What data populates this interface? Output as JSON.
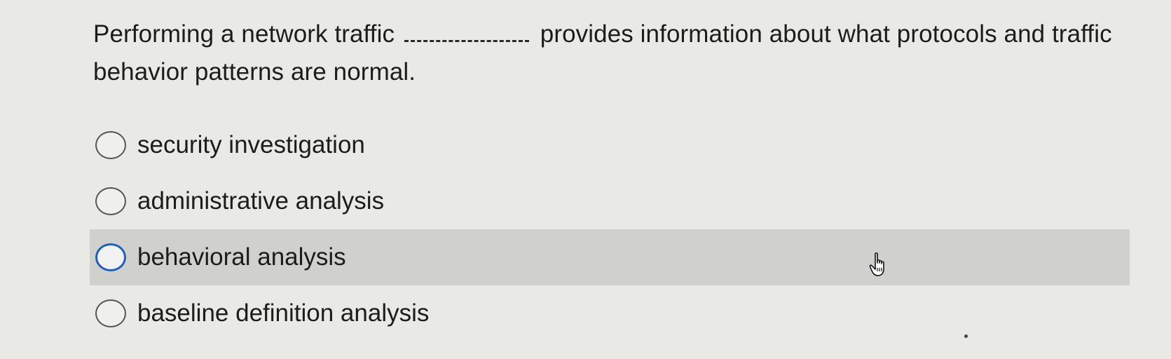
{
  "question": {
    "part1": "Performing a network traffic",
    "part2": "provides information about what protocols and traffic behavior patterns are normal."
  },
  "options": [
    {
      "label": "security investigation"
    },
    {
      "label": "administrative analysis"
    },
    {
      "label": "behavioral analysis"
    },
    {
      "label": "baseline definition analysis"
    }
  ],
  "cursor": {
    "icon": "hand-pointer-icon"
  },
  "colors": {
    "background": "#e9e9e6",
    "hover_row": "#d0d0cd",
    "radio_focus": "#1f5fbf",
    "text": "#1c1c1c"
  }
}
